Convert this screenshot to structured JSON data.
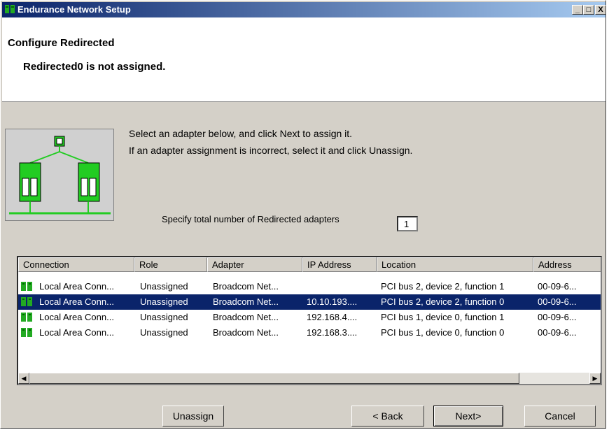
{
  "window": {
    "title": "Endurance Network Setup",
    "controls": {
      "minimize": "_",
      "maximize": "□",
      "close": "X"
    }
  },
  "header": {
    "title": "Configure Redirected",
    "subtitle": "Redirected0 is not assigned."
  },
  "instructions": {
    "line1": "Select an adapter below, and click Next to assign it.",
    "line2": "If an adapter assignment is incorrect, select it and click Unassign."
  },
  "adapter_count": {
    "label": "Specify total number of Redirected adapters",
    "value": "1"
  },
  "list": {
    "columns": [
      "Connection",
      "Role",
      "Adapter",
      "IP Address",
      "Location",
      "Address"
    ],
    "rows": [
      {
        "connection": "Local Area Conn...",
        "role": "Unassigned",
        "adapter": "Broadcom Net...",
        "ip": "",
        "location": "PCI bus 2, device 2, function 1",
        "address": "00-09-6...",
        "selected": false
      },
      {
        "connection": "Local Area Conn...",
        "role": "Unassigned",
        "adapter": "Broadcom Net...",
        "ip": "10.10.193....",
        "location": "PCI bus 2, device 2, function 0",
        "address": "00-09-6...",
        "selected": true
      },
      {
        "connection": "Local Area Conn...",
        "role": "Unassigned",
        "adapter": "Broadcom Net...",
        "ip": "192.168.4....",
        "location": "PCI bus 1, device 0, function 1",
        "address": "00-09-6...",
        "selected": false
      },
      {
        "connection": "Local Area Conn...",
        "role": "Unassigned",
        "adapter": "Broadcom Net...",
        "ip": "192.168.3....",
        "location": "PCI bus 1, device 0, function 0",
        "address": "00-09-6...",
        "selected": false
      }
    ]
  },
  "buttons": {
    "unassign": "Unassign",
    "back": "< Back",
    "next": "Next>",
    "cancel": "Cancel"
  },
  "colors": {
    "selection": "#0a246a",
    "network_green": "#22cc22"
  }
}
